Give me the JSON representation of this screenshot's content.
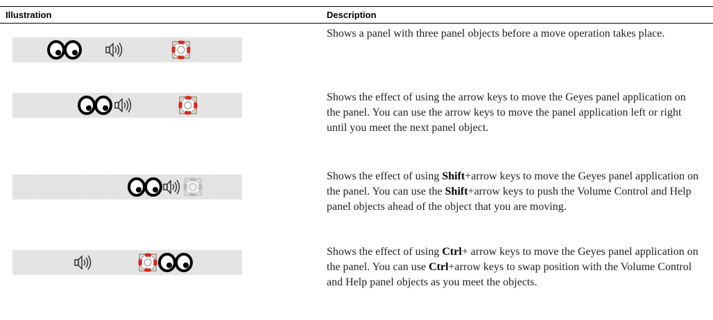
{
  "table": {
    "headers": {
      "illustration": "Illustration",
      "description": "Description"
    },
    "rows": [
      {
        "desc_parts": [
          {
            "text": "Shows a panel with three panel objects before a move operation takes place.",
            "bold": false
          }
        ]
      },
      {
        "desc_parts": [
          {
            "text": "Shows the effect of using the arrow keys to move the Geyes panel application on the panel. You can use the arrow keys to move the panel application left or right until you meet the next panel object.",
            "bold": false
          }
        ]
      },
      {
        "desc_parts": [
          {
            "text": "Shows the effect of using ",
            "bold": false
          },
          {
            "text": "Shift",
            "bold": true
          },
          {
            "text": "+arrow keys to move the Geyes panel application on the panel. You can use the ",
            "bold": false
          },
          {
            "text": "Shift",
            "bold": true
          },
          {
            "text": "+arrow keys to push the Volume Control and Help panel objects ahead of the object that you are moving.",
            "bold": false
          }
        ]
      },
      {
        "desc_parts": [
          {
            "text": "Shows the effect of using ",
            "bold": false
          },
          {
            "text": "Ctrl",
            "bold": true
          },
          {
            "text": "+ arrow keys to move the Geyes panel application on the panel. You can use ",
            "bold": false
          },
          {
            "text": "Ctrl",
            "bold": true
          },
          {
            "text": "+arrow keys to swap position with the Volume Control and Help panel objects as you meet the objects.",
            "bold": false
          }
        ]
      }
    ]
  },
  "icons": {
    "eyes": "geyes-icon",
    "speaker": "volume-control-icon",
    "lifering": "help-icon"
  }
}
